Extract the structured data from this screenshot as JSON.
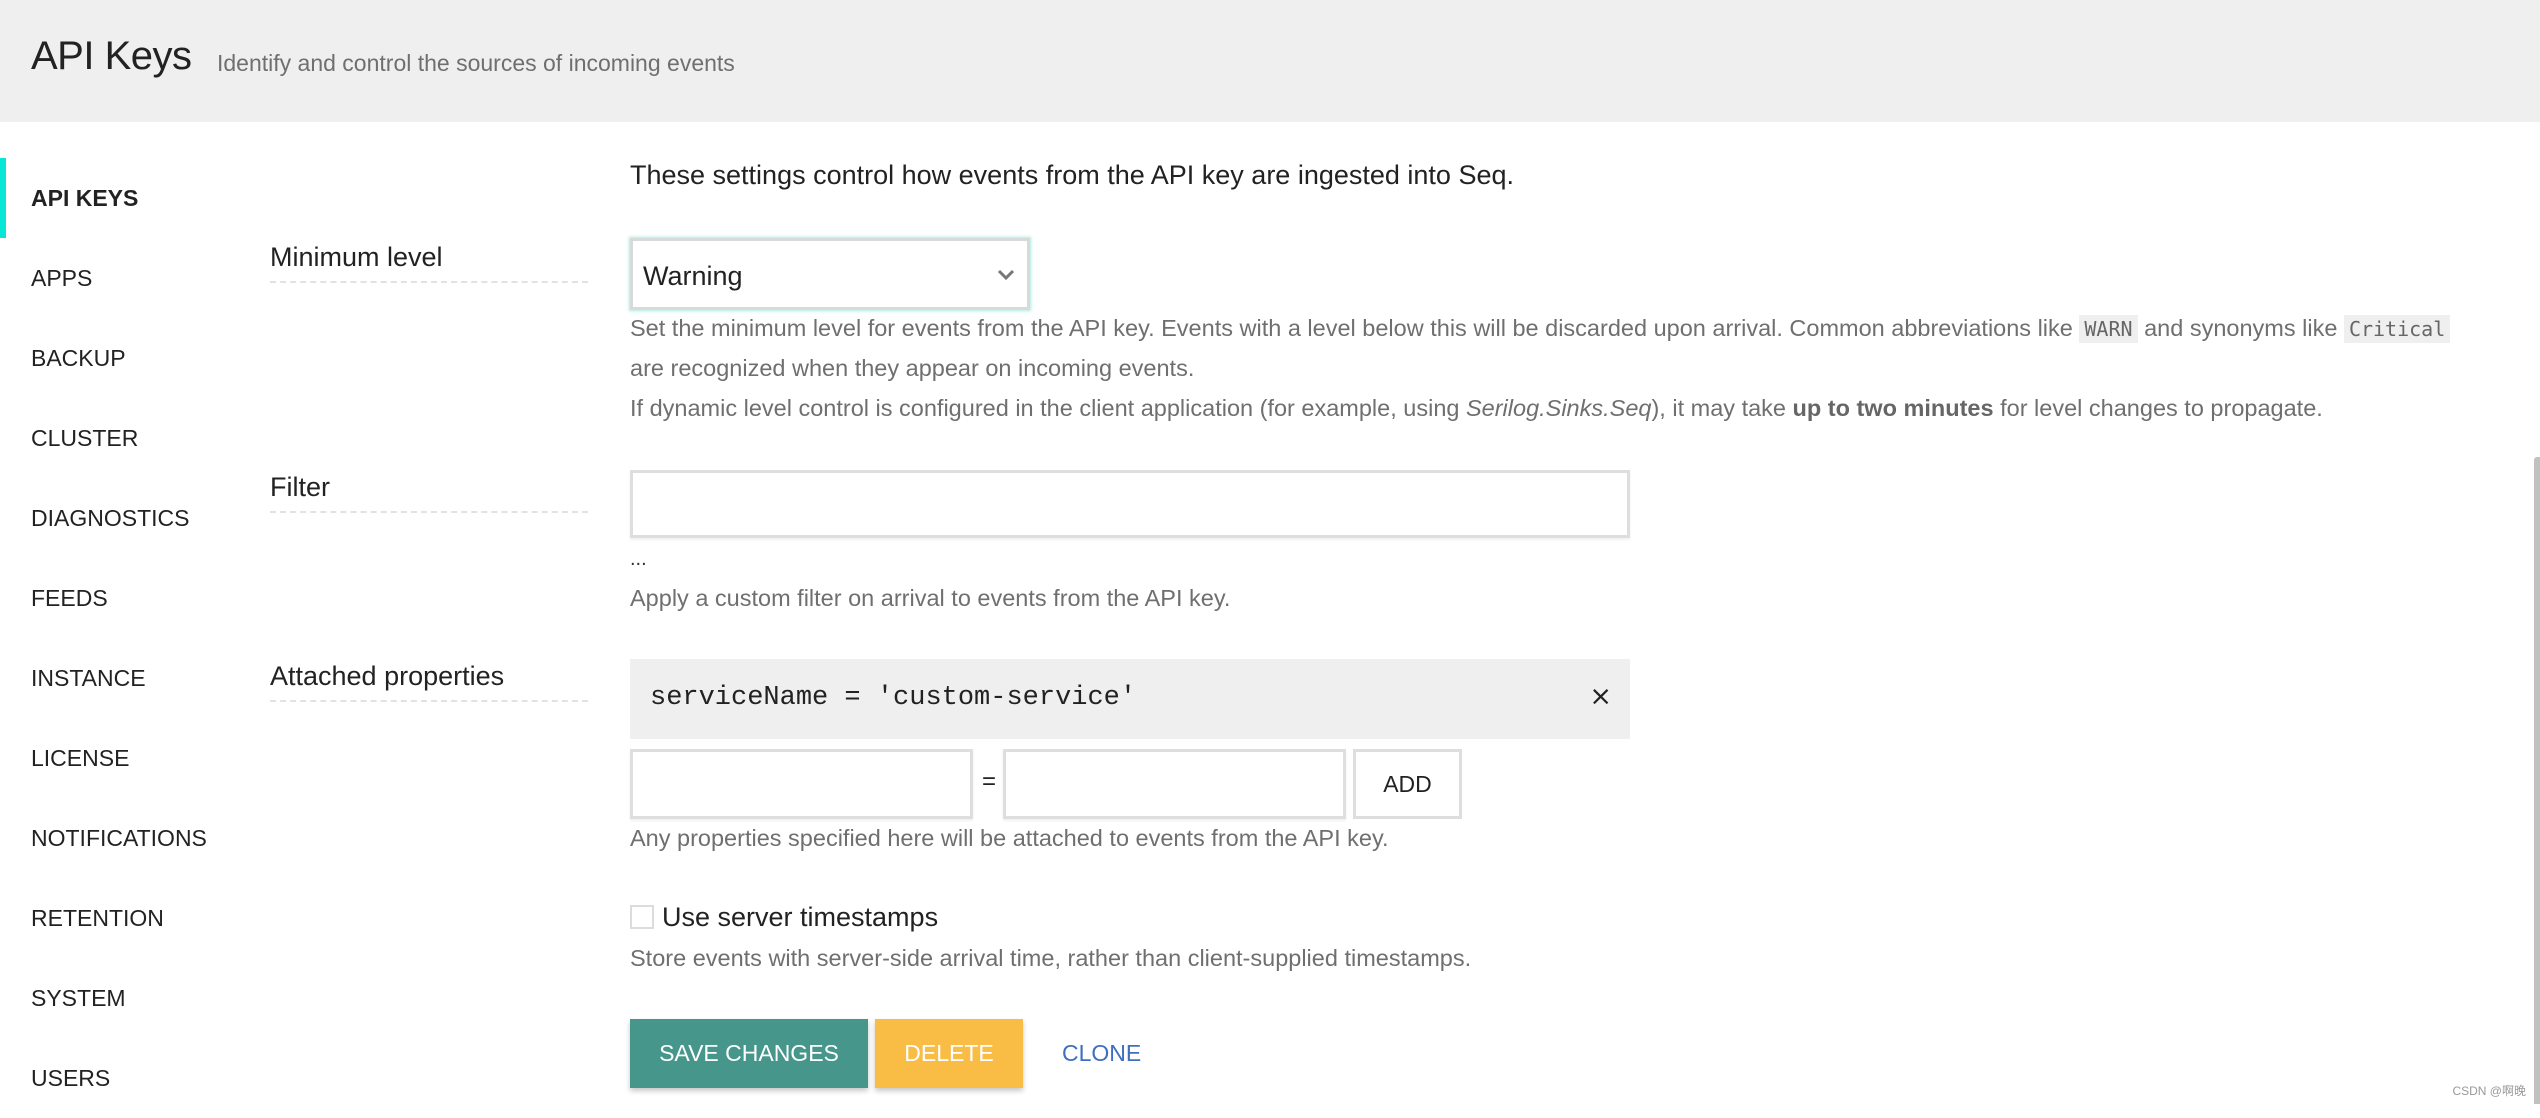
{
  "header": {
    "title": "API Keys",
    "subtitle": "Identify and control the sources of incoming events"
  },
  "sidebar": {
    "active_index": 0,
    "accent_color": "#08e6d5",
    "items": [
      {
        "label": "API KEYS"
      },
      {
        "label": "APPS"
      },
      {
        "label": "BACKUP"
      },
      {
        "label": "CLUSTER"
      },
      {
        "label": "DIAGNOSTICS"
      },
      {
        "label": "FEEDS"
      },
      {
        "label": "INSTANCE"
      },
      {
        "label": "LICENSE"
      },
      {
        "label": "NOTIFICATIONS"
      },
      {
        "label": "RETENTION"
      },
      {
        "label": "SYSTEM"
      },
      {
        "label": "USERS"
      }
    ]
  },
  "form": {
    "intro": "These settings control how events from the API key are ingested into Seq.",
    "minimum_level": {
      "label": "Minimum level",
      "value": "Warning",
      "help_line1_pre": "Set the minimum level for events from the API key. Events with a level below this will be discarded upon arrival. Common abbreviations like ",
      "help_code1": "WARN",
      "help_line1_mid": " and synonyms like ",
      "help_code2": "Critical",
      "help_line2": "are recognized when they appear on incoming events.",
      "help_line3_pre": "If dynamic level control is configured in the client application (for example, using ",
      "help_line3_em": "Serilog.Sinks.Seq",
      "help_line3_mid": "), it may take ",
      "help_line3_bold": "up to two minutes",
      "help_line3_post": " for level changes to propagate."
    },
    "filter": {
      "label": "Filter",
      "value": "",
      "ellipsis": "...",
      "help": "Apply a custom filter on arrival to events from the API key."
    },
    "attached_properties": {
      "label": "Attached properties",
      "items": [
        {
          "text": "serviceName = 'custom-service'",
          "remove_label": "×"
        }
      ],
      "name_value": "",
      "equals": "=",
      "value_value": "",
      "add_label": "ADD",
      "help": "Any properties specified here will be attached to events from the API key."
    },
    "server_timestamps": {
      "checked": false,
      "label": "Use server timestamps",
      "help": "Store events with server-side arrival time, rather than client-supplied timestamps."
    }
  },
  "actions": {
    "save_label": "SAVE CHANGES",
    "delete_label": "DELETE",
    "clone_label": "CLONE",
    "save_color": "#46968c",
    "delete_color": "#f9bd45",
    "clone_color": "#3e6fc1"
  },
  "watermark": "CSDN @啊晚"
}
